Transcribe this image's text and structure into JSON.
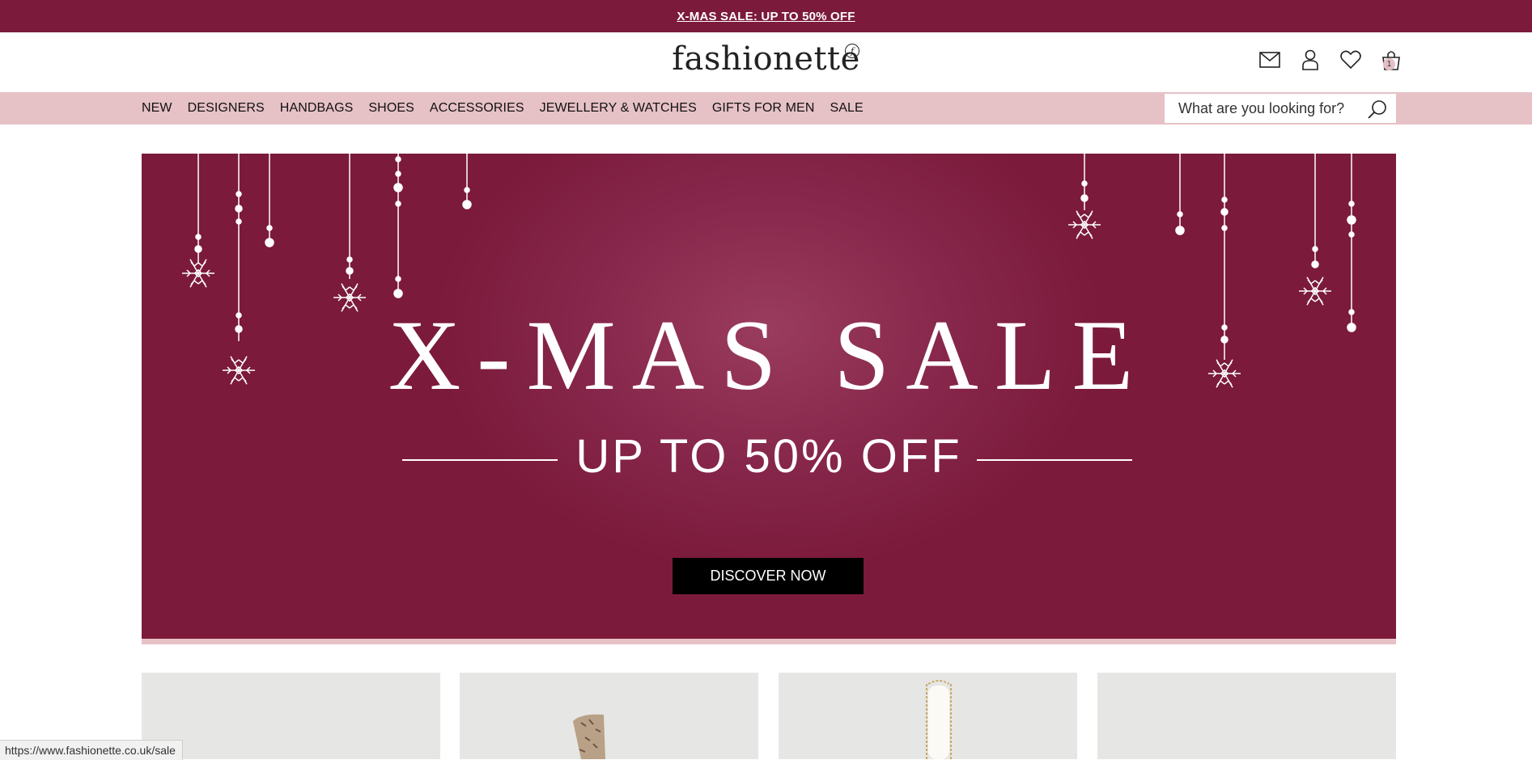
{
  "topbar": {
    "promo_label": "X-MAS SALE: UP TO 50% OFF"
  },
  "header": {
    "logo_text": "fashionette",
    "logo_mark": "f",
    "icons": [
      "mail-icon",
      "user-icon",
      "heart-icon",
      "cart-icon"
    ],
    "cart_count": "1"
  },
  "nav": {
    "items": [
      {
        "label": "NEW"
      },
      {
        "label": "DESIGNERS"
      },
      {
        "label": "HANDBAGS"
      },
      {
        "label": "SHOES"
      },
      {
        "label": "ACCESSORIES"
      },
      {
        "label": "JEWELLERY & WATCHES"
      },
      {
        "label": "GIFTS FOR MEN"
      },
      {
        "label": "SALE"
      }
    ]
  },
  "search": {
    "placeholder": "What are you looking for?"
  },
  "hero": {
    "title": "X-MAS SALE",
    "subtitle": "UP TO 50% OFF",
    "cta_label": "DISCOVER NOW"
  },
  "status_bar": {
    "url": "https://www.fashionette.co.uk/sale"
  },
  "colors": {
    "brand": "#7b1a3a",
    "nav_bg": "#e6c1c6",
    "cta_bg": "#000000",
    "card_bg": "#e6e6e4"
  }
}
